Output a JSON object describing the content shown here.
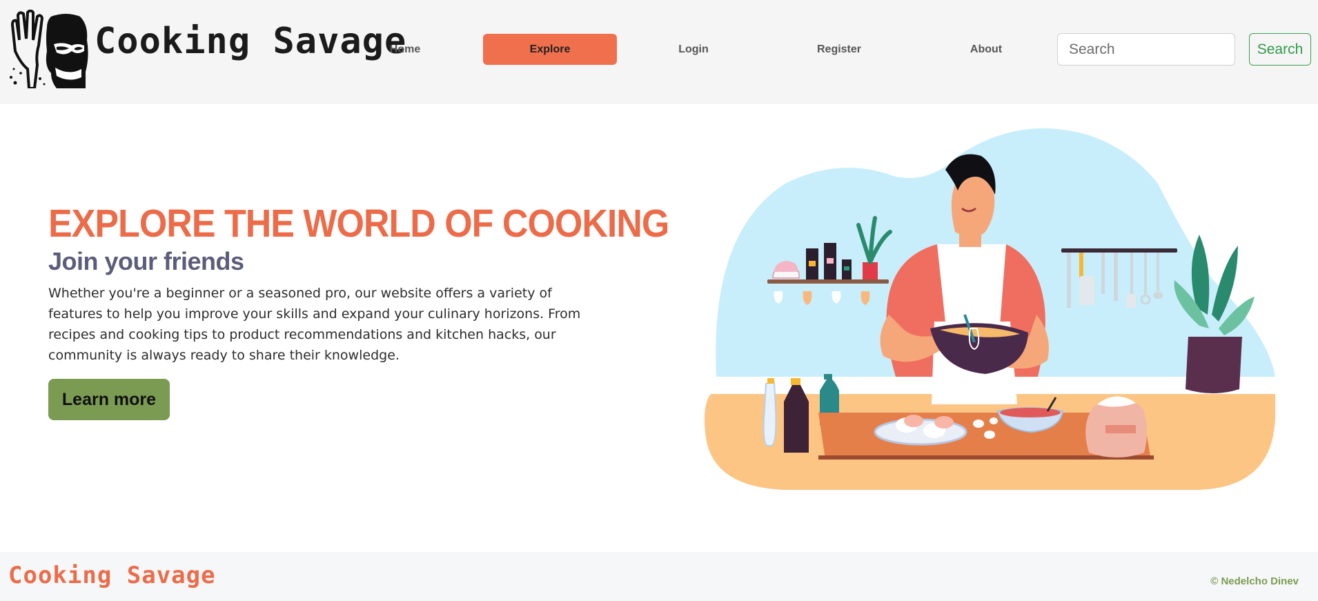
{
  "header": {
    "brand": "Cooking Savage",
    "nav": {
      "home": "Home",
      "explore": "Explore",
      "login": "Login",
      "register": "Register",
      "about": "About"
    },
    "search": {
      "placeholder": "Search",
      "button_label": "Search"
    }
  },
  "hero": {
    "title": "EXPLORE THE WORLD OF COOKING",
    "subtitle": "Join your friends",
    "text": "Whether you're a beginner or a seasoned pro, our website offers a variety of features to help you improve your skills and expand your culinary horizons. From recipes and cooking tips to product recommendations and kitchen hacks, our community is always ready to share their knowledge.",
    "button_label": "Learn more"
  },
  "footer": {
    "brand": "Cooking Savage",
    "credit": "© Nedelcho Dinev"
  },
  "colors": {
    "accent": "#f0704e",
    "green": "#7b9b52",
    "search_green": "#2f9a47"
  },
  "icons": {
    "logo": "savage-face-logo-icon",
    "illustration": "chef-cooking-illustration"
  }
}
